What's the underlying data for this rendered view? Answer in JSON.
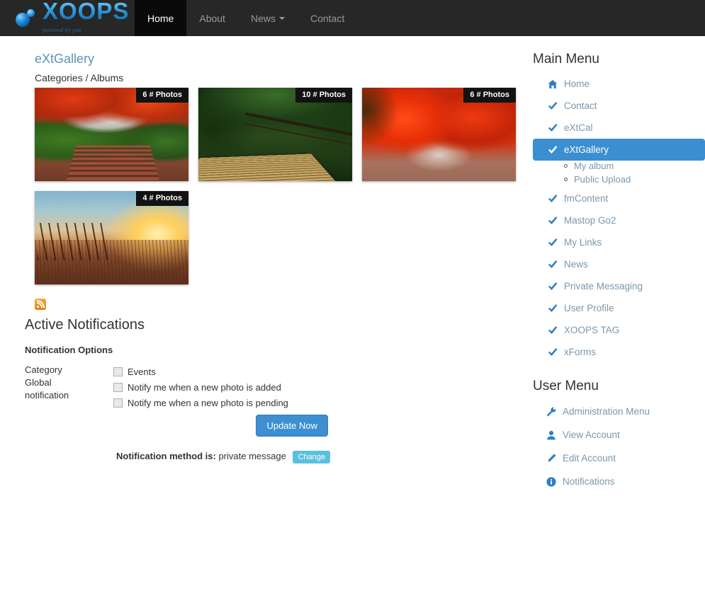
{
  "navbar": {
    "brand": {
      "title": "XOOPS",
      "tagline": "powered by you",
      "icon": "xoops-orb-logo"
    },
    "links": [
      {
        "label": "Home",
        "active": true,
        "caret": false
      },
      {
        "label": "About",
        "active": false,
        "caret": false
      },
      {
        "label": "News",
        "active": false,
        "caret": true
      },
      {
        "label": "Contact",
        "active": false,
        "caret": false
      }
    ]
  },
  "gallery": {
    "title": "eXtGallery",
    "breadcrumb": "Categories / Albums",
    "albums": [
      {
        "badge": "6 # Photos",
        "art": "ph-garden",
        "alt": "autumn-garden-steps"
      },
      {
        "badge": "10 # Photos",
        "art": "ph-bridge",
        "alt": "wooden-bridge-forest"
      },
      {
        "badge": "6 # Photos",
        "art": "ph-maple",
        "alt": "red-maple-tree"
      },
      {
        "badge": "4 # Photos",
        "art": "ph-sunset",
        "alt": "sunset-grass-field"
      }
    ]
  },
  "notifications": {
    "rss_icon": "rss-feed-icon",
    "heading": "Active Notifications",
    "options_title": "Notification Options",
    "rows": [
      {
        "label": "Category",
        "bold": false
      },
      {
        "label": "Global",
        "bold": true
      },
      {
        "label": "notification",
        "bold": true
      }
    ],
    "checkboxes": [
      {
        "label": "Events",
        "checked": false
      },
      {
        "label": "Notify me when a new photo is added",
        "checked": false
      },
      {
        "label": "Notify me when a new photo is pending",
        "checked": false
      }
    ],
    "update_button": "Update Now",
    "method_label": "Notification method is:",
    "method_value": "private message",
    "change_badge": "Change"
  },
  "sidebar": {
    "main_menu": {
      "title": "Main Menu",
      "items": [
        {
          "label": "Home",
          "icon": "home-icon",
          "glyph": "⌂",
          "active": false
        },
        {
          "label": "Contact",
          "icon": "check-icon",
          "glyph": "✔",
          "active": false
        },
        {
          "label": "eXtCal",
          "icon": "check-icon",
          "glyph": "✔",
          "active": false
        },
        {
          "label": "eXtGallery",
          "icon": "check-icon",
          "glyph": "✔",
          "active": true,
          "submenu": [
            {
              "label": "My album"
            },
            {
              "label": "Public Upload"
            }
          ]
        },
        {
          "label": "fmContent",
          "icon": "check-icon",
          "glyph": "✔",
          "active": false
        },
        {
          "label": "Mastop Go2",
          "icon": "check-icon",
          "glyph": "✔",
          "active": false
        },
        {
          "label": "My Links",
          "icon": "check-icon",
          "glyph": "✔",
          "active": false
        },
        {
          "label": "News",
          "icon": "check-icon",
          "glyph": "✔",
          "active": false
        },
        {
          "label": "Private Messaging",
          "icon": "check-icon",
          "glyph": "✔",
          "active": false
        },
        {
          "label": "User Profile",
          "icon": "check-icon",
          "glyph": "✔",
          "active": false
        },
        {
          "label": "XOOPS TAG",
          "icon": "check-icon",
          "glyph": "✔",
          "active": false
        },
        {
          "label": "xForms",
          "icon": "check-icon",
          "glyph": "✔",
          "active": false
        }
      ]
    },
    "user_menu": {
      "title": "User Menu",
      "items": [
        {
          "label": "Administration Menu",
          "icon": "wrench-icon",
          "glyph": "🔧"
        },
        {
          "label": "View Account",
          "icon": "user-icon",
          "glyph": "👤"
        },
        {
          "label": "Edit Account",
          "icon": "pencil-icon",
          "glyph": "✎"
        },
        {
          "label": "Notifications",
          "icon": "info-icon",
          "glyph": "ℹ"
        }
      ]
    }
  },
  "colors": {
    "accent": "#3b8ed0",
    "nav_bg": "#272727",
    "nav_active_bg": "#0a0a0a",
    "link": "#7a98ad",
    "rss": "#df8316",
    "badge_info": "#5bc0de"
  }
}
